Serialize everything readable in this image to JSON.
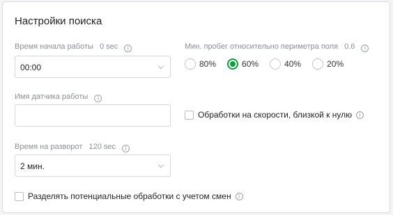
{
  "title": "Настройки поиска",
  "start_time": {
    "label": "Время начала работы",
    "value_hint": "0 sec",
    "selected": "00:00"
  },
  "sensor_name": {
    "label": "Имя датчика работы",
    "value": ""
  },
  "turn_time": {
    "label": "Время на разворот",
    "value_hint": "120 sec",
    "selected": "2 мин."
  },
  "min_run": {
    "label": "Мин. пробег относительно периметра поля",
    "value_hint": "0.6",
    "options": [
      {
        "label": "80%",
        "checked": false
      },
      {
        "label": "60%",
        "checked": true
      },
      {
        "label": "40%",
        "checked": false
      },
      {
        "label": "20%",
        "checked": false
      }
    ]
  },
  "near_zero_speed": {
    "label": "Обработки на скорости, близкой к нулю",
    "checked": false
  },
  "split_by_shift": {
    "label": "Разделять потенциальные обработки с учетом смен",
    "checked": false
  },
  "icons": {
    "info": "info-icon",
    "chevron": "chevron-down-icon"
  },
  "colors": {
    "accent": "#0e9d3b"
  }
}
